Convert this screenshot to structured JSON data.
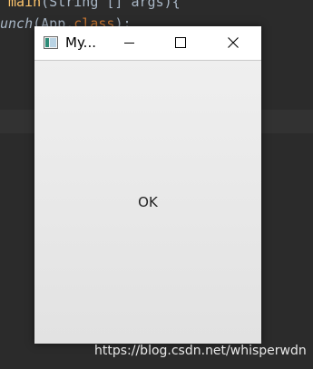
{
  "editor": {
    "line1": {
      "part1": " ",
      "keyword": "main",
      "rest": "(String [] args){"
    },
    "line2": {
      "italic": "unch",
      "rest": "(App.",
      "keyword": "class",
      "tail": ");"
    }
  },
  "window": {
    "title": "My...",
    "icon": "application-window-icon",
    "controls": {
      "minimize_icon": "minimize-icon",
      "maximize_icon": "maximize-icon",
      "close_icon": "close-icon"
    },
    "button_label": "OK"
  },
  "watermark": "https://blog.csdn.net/whisperwdn",
  "colors": {
    "editor_background": "#2b2b2b",
    "code_text": "#a9b7c6",
    "code_keyword": "#cc7832",
    "code_function": "#ffc66d",
    "window_titlebar": "#ffffff",
    "window_content_top": "#efefef",
    "window_content_bottom": "#e2e2e2"
  }
}
